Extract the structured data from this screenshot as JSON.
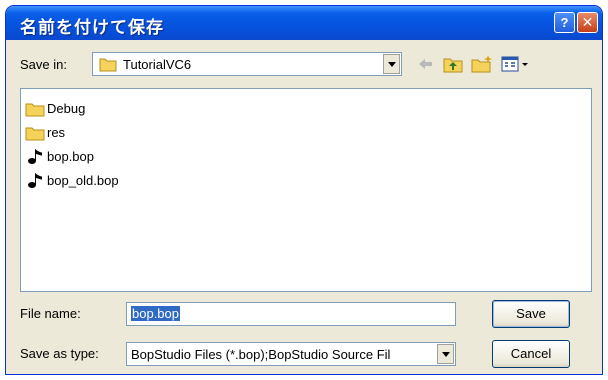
{
  "window": {
    "title": "名前を付けて保存"
  },
  "title_buttons": {
    "help": "?",
    "close": "✕"
  },
  "save_in": {
    "label": "Save in:",
    "value": "TutorialVC6"
  },
  "toolbar": {
    "icons": [
      "back-arrow-icon",
      "up-folder-icon",
      "new-folder-icon",
      "view-menu-icon"
    ]
  },
  "files": [
    {
      "name": "Debug",
      "icon": "folder-icon"
    },
    {
      "name": "res",
      "icon": "folder-icon"
    },
    {
      "name": "bop.bop",
      "icon": "music-note-icon"
    },
    {
      "name": "bop_old.bop",
      "icon": "music-note-icon"
    }
  ],
  "file_name": {
    "label": "File name:",
    "value": "bop.bop"
  },
  "save_as_type": {
    "label": "Save as type:",
    "value": "BopStudio Files (*.bop);BopStudio Source Fil"
  },
  "buttons": {
    "save": "Save",
    "cancel": "Cancel"
  },
  "colors": {
    "title_blue": "#0553df",
    "selection": "#316ac5",
    "dialog_bg": "#ece9d8"
  }
}
